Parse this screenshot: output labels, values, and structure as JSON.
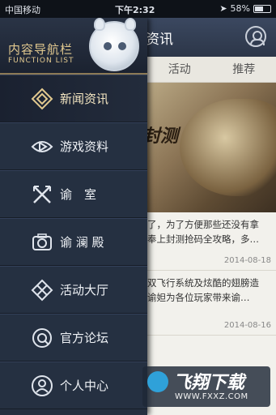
{
  "status_bar": {
    "carrier": "中国移动",
    "time": "下午2:32",
    "battery": "58%",
    "battery_level": 0.58
  },
  "main": {
    "header_title": "资讯",
    "tabs": [
      "活动",
      "推荐"
    ],
    "banner_text": "封测",
    "articles": [
      {
        "text_line1": "了，为了方便那些还没有拿",
        "text_line2": "奉上封测抢码全攻略，多…",
        "date": "2014-08-18"
      },
      {
        "text_line1": "双飞行系统及炫酷的翅膀造",
        "text_line2": "谕妲为各位玩家带来谕…",
        "date": "2014-08-16"
      }
    ]
  },
  "drawer": {
    "title_cn": "内容导航栏",
    "title_en": "FUNCTION LIST",
    "items": [
      {
        "label": "新闻资讯",
        "icon": "diamond-icon",
        "active": true
      },
      {
        "label": "游戏资料",
        "icon": "play-eye-icon",
        "active": false
      },
      {
        "label": "谕　室",
        "icon": "swords-icon",
        "active": false
      },
      {
        "label": "谕 澜 殿",
        "icon": "camera-icon",
        "active": false
      },
      {
        "label": "活动大厅",
        "icon": "star-diamond-icon",
        "active": false
      },
      {
        "label": "官方论坛",
        "icon": "forum-ring-icon",
        "active": false
      },
      {
        "label": "个人中心",
        "icon": "user-icon",
        "active": false
      }
    ]
  },
  "watermark": {
    "title": "飞翔下载",
    "url": "WWW.FXXZ.COM"
  },
  "colors": {
    "drawer_bg": "#253041",
    "accent_gold": "#e2c98f",
    "header_blue": "#2c3648"
  }
}
